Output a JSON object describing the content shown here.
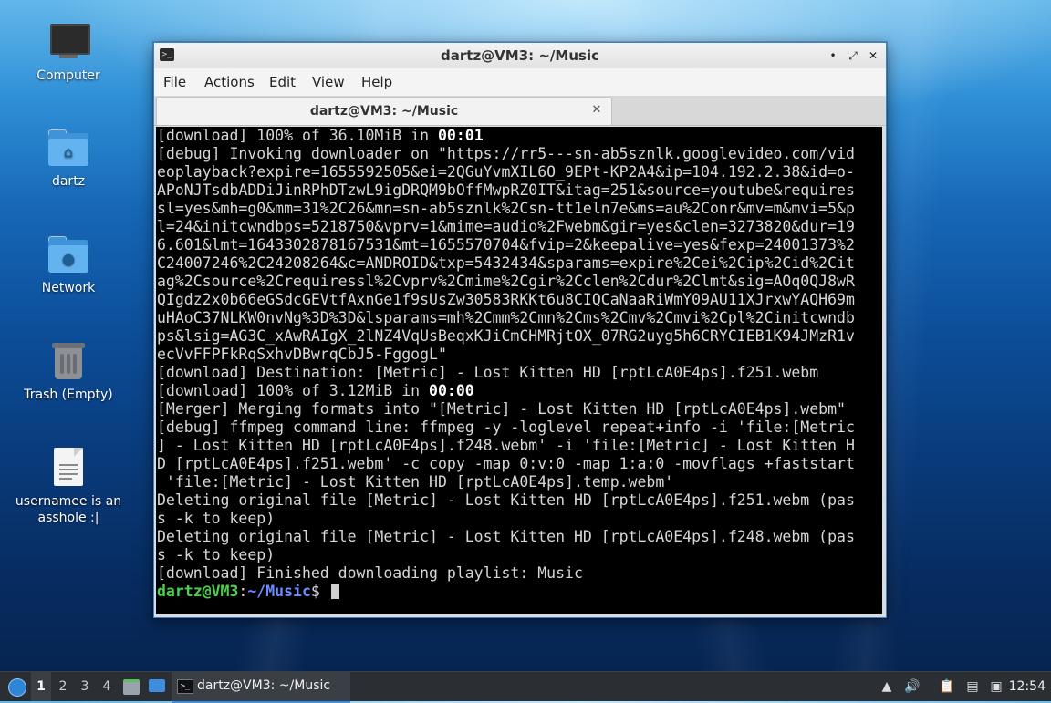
{
  "desktop": {
    "icons": [
      {
        "label": "Computer"
      },
      {
        "label": "dartz"
      },
      {
        "label": "Network"
      },
      {
        "label": "Trash (Empty)"
      },
      {
        "label": "usernamee is an asshole :|"
      }
    ]
  },
  "window": {
    "title": "dartz@VM3: ~/Music",
    "controls": {
      "minimize": "•",
      "maximize": "⤢",
      "close": "✕"
    },
    "menu": [
      "File",
      "Actions",
      "Edit",
      "View",
      "Help"
    ],
    "tab": {
      "label": "dartz@VM3: ~/Music",
      "close": "✕"
    }
  },
  "terminal": {
    "line0": {
      "pre": "[download] 100% of 36.10MiB in ",
      "bold": "00:01"
    },
    "lines": [
      "[debug] Invoking downloader on \"https://rr5---sn-ab5sznlk.googlevideo.com/vid",
      "eoplayback?expire=1655592505&ei=2QGuYvmXIL6O_9EPt-KP2A4&ip=104.192.2.38&id=o-",
      "APoNJTsdbADDiJinRPhDTzwL9igDRQM9bOffMwpRZ0IT&itag=251&source=youtube&requires",
      "sl=yes&mh=g0&mm=31%2C26&mn=sn-ab5sznlk%2Csn-tt1eln7e&ms=au%2Conr&mv=m&mvi=5&p",
      "l=24&initcwndbps=5218750&vprv=1&mime=audio%2Fwebm&gir=yes&clen=3273820&dur=19",
      "6.601&lmt=1643302878167531&mt=1655570704&fvip=2&keepalive=yes&fexp=24001373%2",
      "C24007246%2C24208264&c=ANDROID&txp=5432434&sparams=expire%2Cei%2Cip%2Cid%2Cit",
      "ag%2Csource%2Crequiressl%2Cvprv%2Cmime%2Cgir%2Cclen%2Cdur%2Clmt&sig=AOq0QJ8wR",
      "QIgdz2x0b66eGSdcGEVtfAxnGe1f9sUsZw30583RKKt6u8CIQCaNaaRiWmY09AU11XJrxwYAQH69m",
      "uHAoC37NLKW0nvNg%3D%3D&lsparams=mh%2Cmm%2Cmn%2Cms%2Cmv%2Cmvi%2Cpl%2Cinitcwndb",
      "ps&lsig=AG3C_xAwRAIgX_2lNZ4VqUsBeqxKJiCmCHMRjtOX_07RG2uyg5h6CRYCIEB1K94JMzR1v",
      "ecVvFFPFkRqSxhvDBwrqCbJ5-FggogL\"",
      "[download] Destination: [Metric] - Lost Kitten HD [rptLcA0E4ps].f251.webm"
    ],
    "line14": {
      "pre": "[download] 100% of 3.12MiB in ",
      "bold": "00:00"
    },
    "lines2": [
      "[Merger] Merging formats into \"[Metric] - Lost Kitten HD [rptLcA0E4ps].webm\"",
      "[debug] ffmpeg command line: ffmpeg -y -loglevel repeat+info -i 'file:[Metric",
      "] - Lost Kitten HD [rptLcA0E4ps].f248.webm' -i 'file:[Metric] - Lost Kitten H",
      "D [rptLcA0E4ps].f251.webm' -c copy -map 0:v:0 -map 1:a:0 -movflags +faststart",
      " 'file:[Metric] - Lost Kitten HD [rptLcA0E4ps].temp.webm'",
      "Deleting original file [Metric] - Lost Kitten HD [rptLcA0E4ps].f251.webm (pas",
      "s -k to keep)",
      "Deleting original file [Metric] - Lost Kitten HD [rptLcA0E4ps].f248.webm (pas",
      "s -k to keep)",
      "[download] Finished downloading playlist: Music"
    ],
    "prompt": {
      "user_host": "dartz@VM3",
      "sep": ":",
      "path": "~/Music",
      "symbol": "$ "
    }
  },
  "taskbar": {
    "workspaces": [
      "1",
      "2",
      "3",
      "4"
    ],
    "active_workspace": "1",
    "task_label": "dartz@VM3: ~/Music",
    "clock": "12:54"
  }
}
